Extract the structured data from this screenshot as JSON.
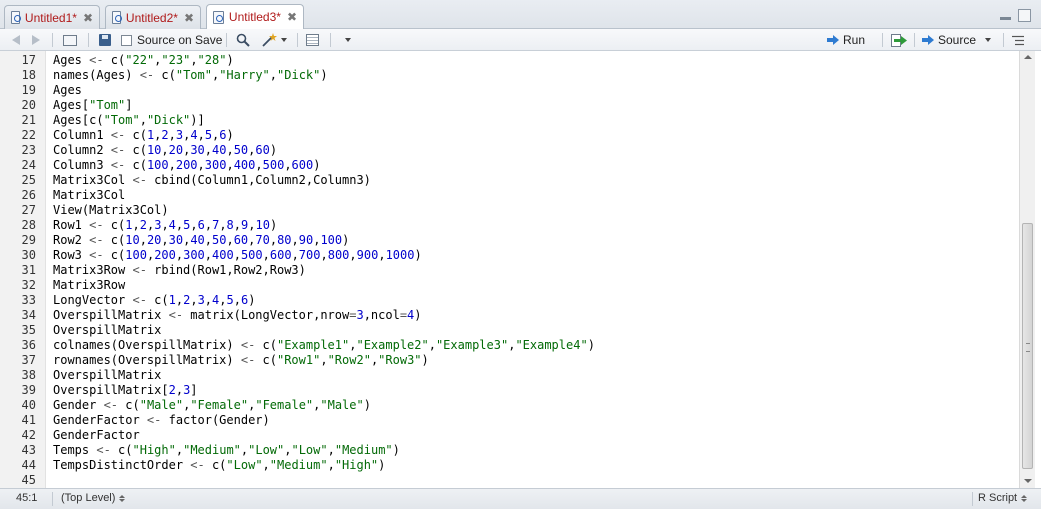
{
  "tabs": [
    {
      "label": "Untitled1*",
      "active": false
    },
    {
      "label": "Untitled2*",
      "active": false
    },
    {
      "label": "Untitled3*",
      "active": true
    }
  ],
  "toolbar": {
    "source_on_save_label": "Source on Save",
    "run_label": "Run",
    "source_label": "Source"
  },
  "editor": {
    "lines": [
      {
        "n": "17",
        "code": [
          [
            "Ages ",
            ""
          ],
          [
            "<-",
            "o"
          ],
          [
            " c(",
            ""
          ],
          [
            "\"22\"",
            "s"
          ],
          [
            ",",
            ""
          ],
          [
            "\"23\"",
            "s"
          ],
          [
            ",",
            ""
          ],
          [
            "\"28\"",
            "s"
          ],
          [
            ")",
            ""
          ]
        ]
      },
      {
        "n": "18",
        "code": [
          [
            "names(Ages) ",
            ""
          ],
          [
            "<-",
            "o"
          ],
          [
            " c(",
            ""
          ],
          [
            "\"Tom\"",
            "s"
          ],
          [
            ",",
            ""
          ],
          [
            "\"Harry\"",
            "s"
          ],
          [
            ",",
            ""
          ],
          [
            "\"Dick\"",
            "s"
          ],
          [
            ")",
            ""
          ]
        ]
      },
      {
        "n": "19",
        "code": [
          [
            "Ages",
            ""
          ]
        ]
      },
      {
        "n": "20",
        "code": [
          [
            "Ages[",
            ""
          ],
          [
            "\"Tom\"",
            "s"
          ],
          [
            "]",
            ""
          ]
        ]
      },
      {
        "n": "21",
        "code": [
          [
            "Ages[c(",
            ""
          ],
          [
            "\"Tom\"",
            "s"
          ],
          [
            ",",
            ""
          ],
          [
            "\"Dick\"",
            "s"
          ],
          [
            ")]",
            ""
          ]
        ]
      },
      {
        "n": "22",
        "code": [
          [
            "Column1 ",
            ""
          ],
          [
            "<-",
            "o"
          ],
          [
            " c(",
            ""
          ],
          [
            "1",
            "n"
          ],
          [
            ",",
            ""
          ],
          [
            "2",
            "n"
          ],
          [
            ",",
            ""
          ],
          [
            "3",
            "n"
          ],
          [
            ",",
            ""
          ],
          [
            "4",
            "n"
          ],
          [
            ",",
            ""
          ],
          [
            "5",
            "n"
          ],
          [
            ",",
            ""
          ],
          [
            "6",
            "n"
          ],
          [
            ")",
            ""
          ]
        ]
      },
      {
        "n": "23",
        "code": [
          [
            "Column2 ",
            ""
          ],
          [
            "<-",
            "o"
          ],
          [
            " c(",
            ""
          ],
          [
            "10",
            "n"
          ],
          [
            ",",
            ""
          ],
          [
            "20",
            "n"
          ],
          [
            ",",
            ""
          ],
          [
            "30",
            "n"
          ],
          [
            ",",
            ""
          ],
          [
            "40",
            "n"
          ],
          [
            ",",
            ""
          ],
          [
            "50",
            "n"
          ],
          [
            ",",
            ""
          ],
          [
            "60",
            "n"
          ],
          [
            ")",
            ""
          ]
        ]
      },
      {
        "n": "24",
        "code": [
          [
            "Column3 ",
            ""
          ],
          [
            "<-",
            "o"
          ],
          [
            " c(",
            ""
          ],
          [
            "100",
            "n"
          ],
          [
            ",",
            ""
          ],
          [
            "200",
            "n"
          ],
          [
            ",",
            ""
          ],
          [
            "300",
            "n"
          ],
          [
            ",",
            ""
          ],
          [
            "400",
            "n"
          ],
          [
            ",",
            ""
          ],
          [
            "500",
            "n"
          ],
          [
            ",",
            ""
          ],
          [
            "600",
            "n"
          ],
          [
            ")",
            ""
          ]
        ]
      },
      {
        "n": "25",
        "code": [
          [
            "Matrix3Col ",
            ""
          ],
          [
            "<-",
            "o"
          ],
          [
            " cbind(Column1,Column2,Column3)",
            ""
          ]
        ]
      },
      {
        "n": "26",
        "code": [
          [
            "Matrix3Col",
            ""
          ]
        ]
      },
      {
        "n": "27",
        "code": [
          [
            "View(Matrix3Col)",
            ""
          ]
        ]
      },
      {
        "n": "28",
        "code": [
          [
            "Row1 ",
            ""
          ],
          [
            "<-",
            "o"
          ],
          [
            " c(",
            ""
          ],
          [
            "1",
            "n"
          ],
          [
            ",",
            ""
          ],
          [
            "2",
            "n"
          ],
          [
            ",",
            ""
          ],
          [
            "3",
            "n"
          ],
          [
            ",",
            ""
          ],
          [
            "4",
            "n"
          ],
          [
            ",",
            ""
          ],
          [
            "5",
            "n"
          ],
          [
            ",",
            ""
          ],
          [
            "6",
            "n"
          ],
          [
            ",",
            ""
          ],
          [
            "7",
            "n"
          ],
          [
            ",",
            ""
          ],
          [
            "8",
            "n"
          ],
          [
            ",",
            ""
          ],
          [
            "9",
            "n"
          ],
          [
            ",",
            ""
          ],
          [
            "10",
            "n"
          ],
          [
            ")",
            ""
          ]
        ]
      },
      {
        "n": "29",
        "code": [
          [
            "Row2 ",
            ""
          ],
          [
            "<-",
            "o"
          ],
          [
            " c(",
            ""
          ],
          [
            "10",
            "n"
          ],
          [
            ",",
            ""
          ],
          [
            "20",
            "n"
          ],
          [
            ",",
            ""
          ],
          [
            "30",
            "n"
          ],
          [
            ",",
            ""
          ],
          [
            "40",
            "n"
          ],
          [
            ",",
            ""
          ],
          [
            "50",
            "n"
          ],
          [
            ",",
            ""
          ],
          [
            "60",
            "n"
          ],
          [
            ",",
            ""
          ],
          [
            "70",
            "n"
          ],
          [
            ",",
            ""
          ],
          [
            "80",
            "n"
          ],
          [
            ",",
            ""
          ],
          [
            "90",
            "n"
          ],
          [
            ",",
            ""
          ],
          [
            "100",
            "n"
          ],
          [
            ")",
            ""
          ]
        ]
      },
      {
        "n": "30",
        "code": [
          [
            "Row3 ",
            ""
          ],
          [
            "<-",
            "o"
          ],
          [
            " c(",
            ""
          ],
          [
            "100",
            "n"
          ],
          [
            ",",
            ""
          ],
          [
            "200",
            "n"
          ],
          [
            ",",
            ""
          ],
          [
            "300",
            "n"
          ],
          [
            ",",
            ""
          ],
          [
            "400",
            "n"
          ],
          [
            ",",
            ""
          ],
          [
            "500",
            "n"
          ],
          [
            ",",
            ""
          ],
          [
            "600",
            "n"
          ],
          [
            ",",
            ""
          ],
          [
            "700",
            "n"
          ],
          [
            ",",
            ""
          ],
          [
            "800",
            "n"
          ],
          [
            ",",
            ""
          ],
          [
            "900",
            "n"
          ],
          [
            ",",
            ""
          ],
          [
            "1000",
            "n"
          ],
          [
            ")",
            ""
          ]
        ]
      },
      {
        "n": "31",
        "code": [
          [
            "Matrix3Row ",
            ""
          ],
          [
            "<-",
            "o"
          ],
          [
            " rbind(Row1,Row2,Row3)",
            ""
          ]
        ]
      },
      {
        "n": "32",
        "code": [
          [
            "Matrix3Row",
            ""
          ]
        ]
      },
      {
        "n": "33",
        "code": [
          [
            "LongVector ",
            ""
          ],
          [
            "<-",
            "o"
          ],
          [
            " c(",
            ""
          ],
          [
            "1",
            "n"
          ],
          [
            ",",
            ""
          ],
          [
            "2",
            "n"
          ],
          [
            ",",
            ""
          ],
          [
            "3",
            "n"
          ],
          [
            ",",
            ""
          ],
          [
            "4",
            "n"
          ],
          [
            ",",
            ""
          ],
          [
            "5",
            "n"
          ],
          [
            ",",
            ""
          ],
          [
            "6",
            "n"
          ],
          [
            ")",
            ""
          ]
        ]
      },
      {
        "n": "34",
        "code": [
          [
            "OverspillMatrix ",
            ""
          ],
          [
            "<-",
            "o"
          ],
          [
            " matrix(LongVector,nrow",
            ""
          ],
          [
            "=",
            "o"
          ],
          [
            "3",
            "n"
          ],
          [
            ",ncol",
            ""
          ],
          [
            "=",
            "o"
          ],
          [
            "4",
            "n"
          ],
          [
            ")",
            ""
          ]
        ]
      },
      {
        "n": "35",
        "code": [
          [
            "OverspillMatrix",
            ""
          ]
        ]
      },
      {
        "n": "36",
        "code": [
          [
            "colnames(OverspillMatrix) ",
            ""
          ],
          [
            "<-",
            "o"
          ],
          [
            " c(",
            ""
          ],
          [
            "\"Example1\"",
            "s"
          ],
          [
            ",",
            ""
          ],
          [
            "\"Example2\"",
            "s"
          ],
          [
            ",",
            ""
          ],
          [
            "\"Example3\"",
            "s"
          ],
          [
            ",",
            ""
          ],
          [
            "\"Example4\"",
            "s"
          ],
          [
            ")",
            ""
          ]
        ]
      },
      {
        "n": "37",
        "code": [
          [
            "rownames(OverspillMatrix) ",
            ""
          ],
          [
            "<-",
            "o"
          ],
          [
            " c(",
            ""
          ],
          [
            "\"Row1\"",
            "s"
          ],
          [
            ",",
            ""
          ],
          [
            "\"Row2\"",
            "s"
          ],
          [
            ",",
            ""
          ],
          [
            "\"Row3\"",
            "s"
          ],
          [
            ")",
            ""
          ]
        ]
      },
      {
        "n": "38",
        "code": [
          [
            "OverspillMatrix",
            ""
          ]
        ]
      },
      {
        "n": "39",
        "code": [
          [
            "OverspillMatrix[",
            ""
          ],
          [
            "2",
            "n"
          ],
          [
            ",",
            ""
          ],
          [
            "3",
            "n"
          ],
          [
            "]",
            ""
          ]
        ]
      },
      {
        "n": "40",
        "code": [
          [
            "Gender ",
            ""
          ],
          [
            "<-",
            "o"
          ],
          [
            " c(",
            ""
          ],
          [
            "\"Male\"",
            "s"
          ],
          [
            ",",
            ""
          ],
          [
            "\"Female\"",
            "s"
          ],
          [
            ",",
            ""
          ],
          [
            "\"Female\"",
            "s"
          ],
          [
            ",",
            ""
          ],
          [
            "\"Male\"",
            "s"
          ],
          [
            ")",
            ""
          ]
        ]
      },
      {
        "n": "41",
        "code": [
          [
            "GenderFactor ",
            ""
          ],
          [
            "<-",
            "o"
          ],
          [
            " factor(Gender)",
            ""
          ]
        ]
      },
      {
        "n": "42",
        "code": [
          [
            "GenderFactor",
            ""
          ]
        ]
      },
      {
        "n": "43",
        "code": [
          [
            "Temps ",
            ""
          ],
          [
            "<-",
            "o"
          ],
          [
            " c(",
            ""
          ],
          [
            "\"High\"",
            "s"
          ],
          [
            ",",
            ""
          ],
          [
            "\"Medium\"",
            "s"
          ],
          [
            ",",
            ""
          ],
          [
            "\"Low\"",
            "s"
          ],
          [
            ",",
            ""
          ],
          [
            "\"Low\"",
            "s"
          ],
          [
            ",",
            ""
          ],
          [
            "\"Medium\"",
            "s"
          ],
          [
            ")",
            ""
          ]
        ]
      },
      {
        "n": "44",
        "code": [
          [
            "TempsDistinctOrder ",
            ""
          ],
          [
            "<-",
            "o"
          ],
          [
            " c(",
            ""
          ],
          [
            "\"Low\"",
            "s"
          ],
          [
            ",",
            ""
          ],
          [
            "\"Medium\"",
            "s"
          ],
          [
            ",",
            ""
          ],
          [
            "\"High\"",
            "s"
          ],
          [
            ")",
            ""
          ]
        ]
      },
      {
        "n": "45",
        "code": []
      }
    ]
  },
  "status": {
    "cursor_position": "45:1",
    "scope": "(Top Level)",
    "file_type": "R Script"
  },
  "colors": {
    "tab_text": "#b01a1a",
    "string": "#036a07",
    "number": "#0000cd",
    "operator": "#555555"
  }
}
